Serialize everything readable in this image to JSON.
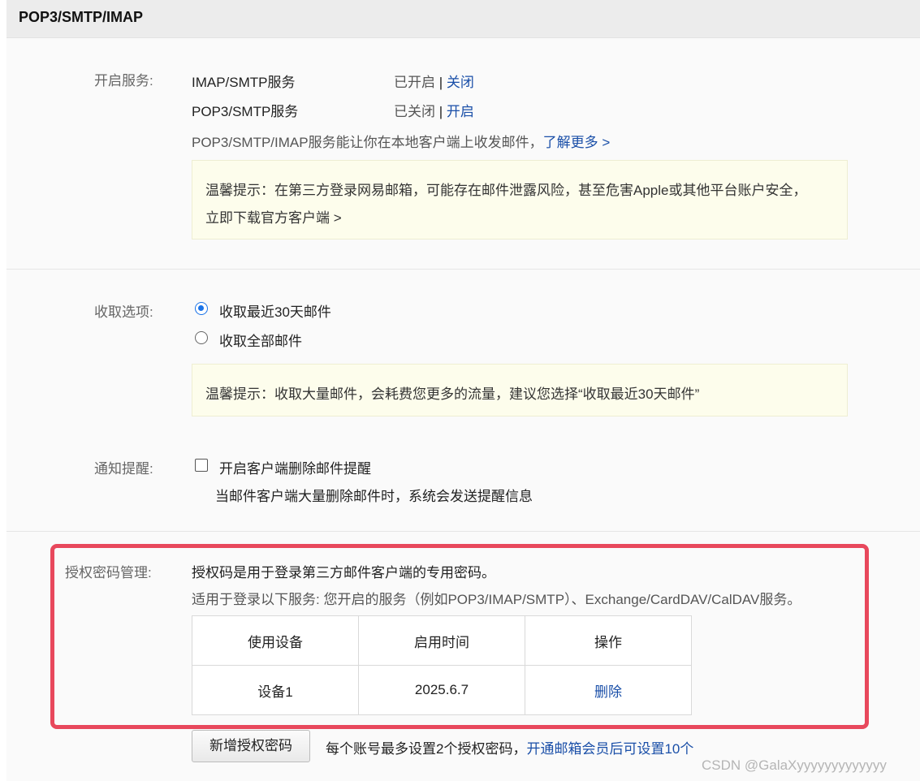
{
  "header": {
    "title": "POP3/SMTP/IMAP"
  },
  "services": {
    "label": "开启服务:",
    "items": [
      {
        "name": "IMAP/SMTP服务",
        "status": "已开启",
        "separator": "|",
        "action": "关闭"
      },
      {
        "name": "POP3/SMTP服务",
        "status": "已关闭",
        "separator": "|",
        "action": "开启"
      }
    ],
    "description": "POP3/SMTP/IMAP服务能让你在本地客户端上收发邮件，",
    "learn_more": "了解更多 >",
    "tip_line1": "温馨提示：在第三方登录网易邮箱，可能存在邮件泄露风险，甚至危害Apple或其他平台账户安全，",
    "tip_link": "立即下载官方客户端 >"
  },
  "receive": {
    "label": "收取选项:",
    "options": [
      {
        "label": "收取最近30天邮件",
        "selected": true
      },
      {
        "label": "收取全部邮件",
        "selected": false
      }
    ],
    "tip": "温馨提示：收取大量邮件，会耗费您更多的流量，建议您选择“收取最近30天邮件”"
  },
  "notify": {
    "label": "通知提醒:",
    "checkbox_label": "开启客户端删除邮件提醒",
    "checked": false,
    "hint": "当邮件客户端大量删除邮件时，系统会发送提醒信息"
  },
  "auth": {
    "label": "授权密码管理:",
    "description": "授权码是用于登录第三方邮件客户端的专用密码。",
    "scope": "适用于登录以下服务: 您开启的服务（例如POP3/IMAP/SMTP）、Exchange/CardDAV/CalDAV服务。",
    "table": {
      "headers": [
        "使用设备",
        "启用时间",
        "操作"
      ],
      "rows": [
        {
          "device": "设备1",
          "date": "2025.6.7",
          "action": "删除"
        }
      ]
    },
    "add_button": "新增授权密码",
    "limit_note": "每个账号最多设置2个授权密码，",
    "vip_link": "开通邮箱会员后可设置10个"
  },
  "colors": {
    "link": "#1a4fa8",
    "highlight": "#e8485c",
    "tip_background": "#fdfdec",
    "radio_selected": "#1a73e8"
  },
  "watermark": "CSDN @GalaXyyyyyyyyyyyyy"
}
